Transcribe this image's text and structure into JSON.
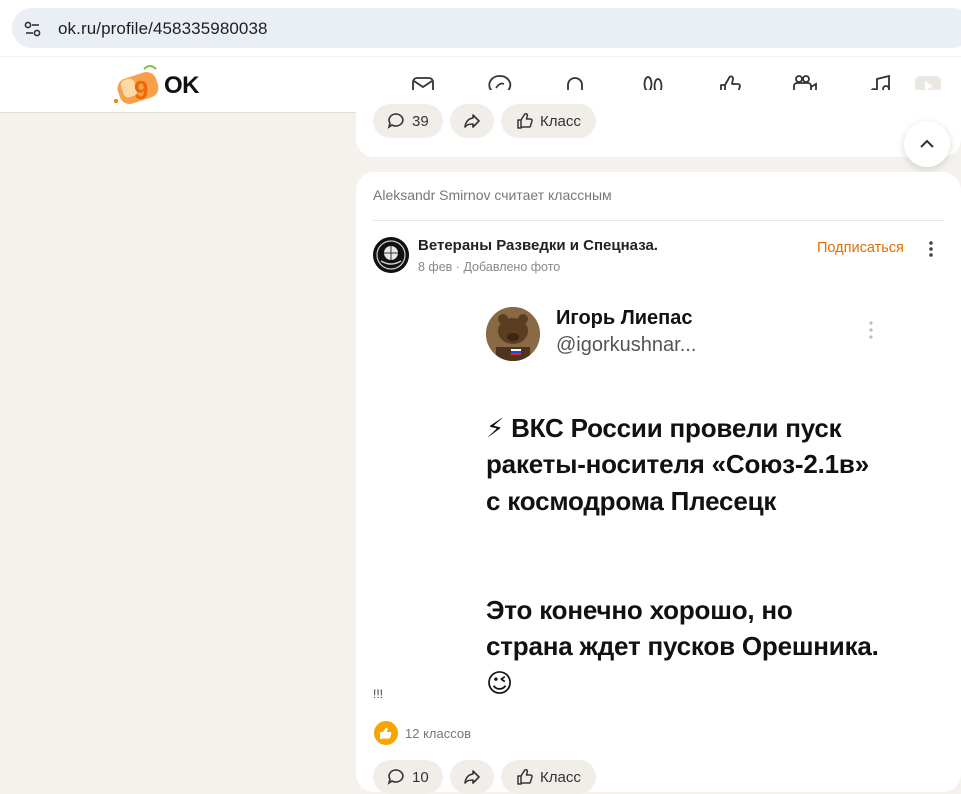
{
  "browser": {
    "url": "ok.ru/profile/458335980038",
    "site_settings_icon": "tune-icon"
  },
  "header": {
    "logo_text": "OK",
    "nav_icons": [
      "messages-icon",
      "discussions-icon",
      "notifications-icon",
      "guests-icon",
      "events-icon",
      "video-icon",
      "music-icon",
      "video-tab-icon"
    ]
  },
  "prev_post": {
    "comments_count": "39",
    "class_label": "Класс"
  },
  "post": {
    "activity": "Aleksandr Smirnov считает классным",
    "group_name": "Ветераны Разведки и Спецназа.",
    "date": "8 фев",
    "meta_sep": "·",
    "meta_action": "Добавлено фото",
    "subscribe": "Подписаться",
    "caption": "!!!",
    "likes_text": "12 классов",
    "comments_count": "10",
    "class_label": "Класс"
  },
  "tweet": {
    "author_name": "Игорь Лиепас",
    "author_handle": "@igorkushnar...",
    "para1": "⚡ ВКС России провели пуск ракеты-носителя «Союз-2.1в» с космодрома Плесецк",
    "para2": "Это конечно хорошо, но страна ждет пусков Орешника. 😉"
  },
  "colors": {
    "accent_orange": "#ee8208",
    "subscribe_orange": "#e06f00",
    "page_bg": "#f5f2ee"
  }
}
